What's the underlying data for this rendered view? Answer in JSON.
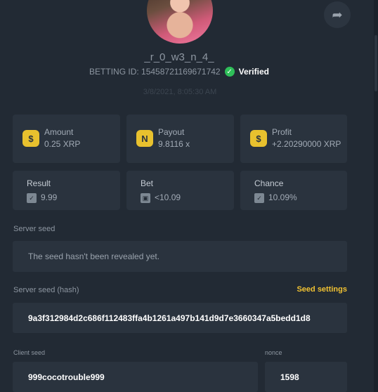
{
  "user": {
    "username": "_r_0_w3_n_4_",
    "bet_id": "BETTING ID: 15458721169671742",
    "verified": "Verified",
    "date": "3/8/2021, 8:05:30 AM"
  },
  "stats": [
    {
      "label": "Amount",
      "value": "0.25 XRP",
      "icon": "money-bag-hand-icon"
    },
    {
      "label": "Payout",
      "value": "9.8116 x",
      "icon": "coins-icon"
    },
    {
      "label": "Profit",
      "value": "+2.20290000 XRP",
      "icon": "money-bag-icon"
    }
  ],
  "details": [
    {
      "label": "Result",
      "value": "9.99"
    },
    {
      "label": "Bet",
      "value": "<10.09"
    },
    {
      "label": "Chance",
      "value": "10.09%"
    }
  ],
  "server_seed": {
    "label": "Server seed",
    "value": "The seed hasn't been revealed yet."
  },
  "server_seed_hash": {
    "label": "Server seed (hash)",
    "link": "Seed settings",
    "value": "9a3f312984d2c686f112483ffa4b1261a497b141d9d7e3660347a5bedd1d8"
  },
  "client_seed": {
    "label": "Client seed",
    "value": "999cocotrouble999"
  },
  "nonce": {
    "label": "nonce",
    "value": "1598"
  },
  "colors": {
    "accent": "#f1c232",
    "verified": "#2fbf59",
    "bg": "#222a34",
    "card": "#2a333e"
  }
}
